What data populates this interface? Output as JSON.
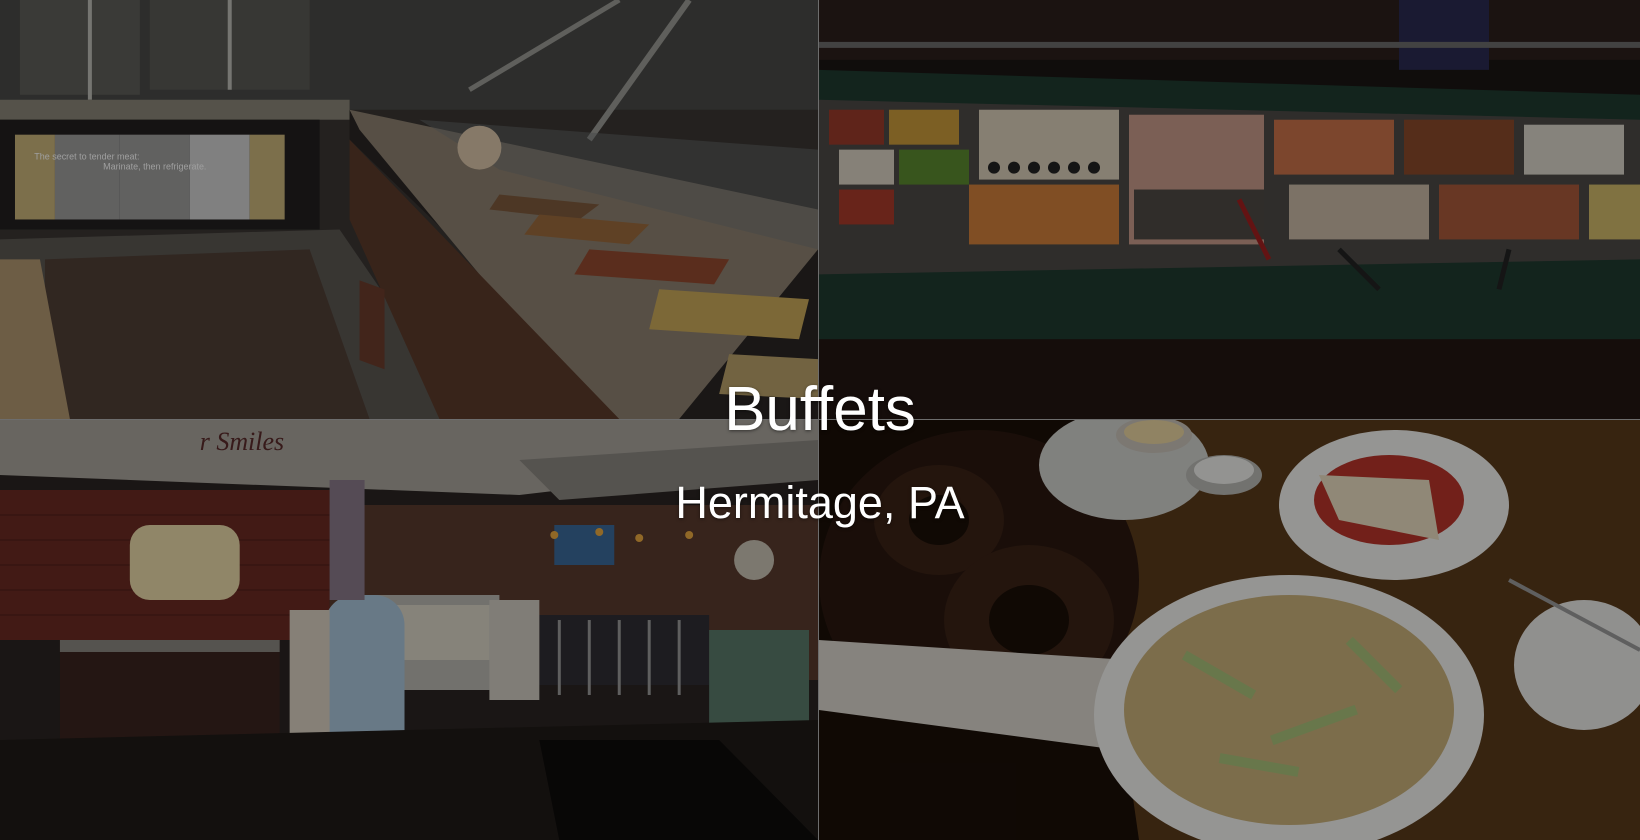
{
  "hero": {
    "title": "Buffets",
    "subtitle": "Hermitage, PA"
  },
  "photos": [
    {
      "subject": "hot-food-buffet-line",
      "signs": [
        "The secret to tender meat:",
        "Marinate, then refrigerate."
      ]
    },
    {
      "subject": "sushi-and-seafood-buffet-bar"
    },
    {
      "subject": "restaurant-interior-bakery-counter"
    },
    {
      "subject": "pretzels-and-fried-appetizer-plates"
    }
  ],
  "colors": {
    "overlay_text": "#ffffff",
    "tile_divider": "#6d6d6d"
  }
}
